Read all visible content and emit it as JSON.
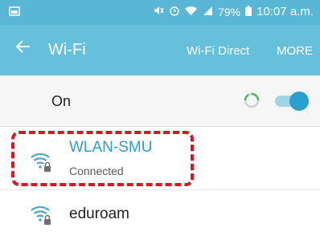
{
  "status_bar": {
    "battery": "79%",
    "time": "10:07 a.m."
  },
  "app_bar": {
    "title": "Wi-Fi",
    "wifi_direct_label": "Wi-Fi Direct",
    "more_label": "MORE"
  },
  "wifi_toggle": {
    "label": "On",
    "state": "on"
  },
  "networks": [
    {
      "name": "WLAN-SMU",
      "status": "Connected",
      "secured": true
    },
    {
      "name": "eduroam",
      "status": "",
      "secured": true
    }
  ],
  "colors": {
    "status_bar": "#5ab6d6",
    "app_bar": "#66c0dc",
    "accent": "#2aa0d0",
    "highlight": "#e0121e"
  }
}
